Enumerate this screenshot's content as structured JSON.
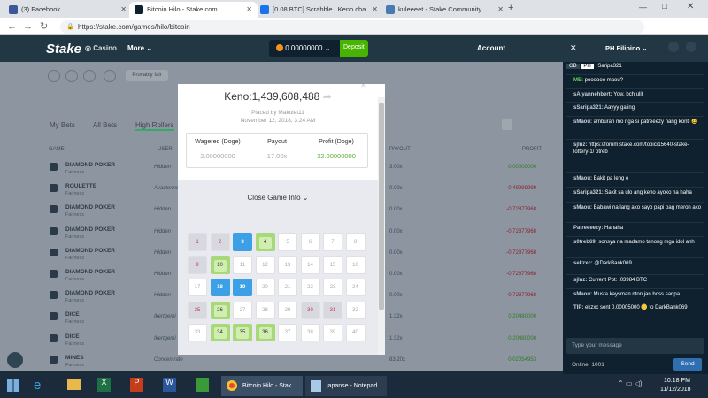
{
  "browser": {
    "tabs": [
      {
        "label": "(3) Facebook",
        "color": "#3b5998"
      },
      {
        "label": "Bitcoin Hilo - Stake.com",
        "color": "#0f212e"
      },
      {
        "label": "[0.08 BTC] Scrabble | Keno cha...",
        "color": "#1a73e8"
      },
      {
        "label": "kuleeeet - Stake Community",
        "color": "#4a7bb0"
      }
    ],
    "url": "https://stake.com/games/hilo/bitcoin"
  },
  "site": {
    "logo": "Stake",
    "casino": "Casino",
    "more": "More",
    "balance": "0.00000000",
    "deposit": "Deposit",
    "account": "Account",
    "favorite_btn": "Provably fair"
  },
  "bets": {
    "tabs": [
      "My Bets",
      "All Bets",
      "High Rollers"
    ],
    "headers": [
      "GAME",
      "USER",
      "PAYOUT",
      "PROFIT"
    ],
    "rows": [
      {
        "game": "DIAMOND POKER",
        "sub": "Fairness",
        "user": "Hidden",
        "mult": "3.00x",
        "profit": "0.00000000",
        "pos": true
      },
      {
        "game": "ROULETTE",
        "sub": "Fairness",
        "user": "Avasterine",
        "mult": "0.00x",
        "profit": "-0.49999999",
        "pos": false
      },
      {
        "game": "DIAMOND POKER",
        "sub": "Fairness",
        "user": "Hidden",
        "mult": "0.00x",
        "profit": "-0.72877968",
        "pos": false
      },
      {
        "game": "DIAMOND POKER",
        "sub": "Fairness",
        "user": "Hidden",
        "mult": "0.00x",
        "profit": "-0.72877968",
        "pos": false
      },
      {
        "game": "DIAMOND POKER",
        "sub": "Fairness",
        "user": "Hidden",
        "mult": "0.00x",
        "profit": "-0.72877968",
        "pos": false
      },
      {
        "game": "DIAMOND POKER",
        "sub": "Fairness",
        "user": "Hidden",
        "mult": "0.00x",
        "profit": "-0.72877968",
        "pos": false
      },
      {
        "game": "DIAMOND POKER",
        "sub": "Fairness",
        "user": "Hidden",
        "mult": "0.00x",
        "profit": "-0.72877968",
        "pos": false
      },
      {
        "game": "DICE",
        "sub": "Fairness",
        "user": "Ikertgemi",
        "mult": "1.32x",
        "profit": "0.20480000",
        "pos": true
      },
      {
        "game": "DICE",
        "sub": "Fairness",
        "user": "Ikertgemi",
        "mult": "1.32x",
        "profit": "0.20480000",
        "pos": true
      },
      {
        "game": "MINES",
        "sub": "Fairness",
        "user": "Concentrate",
        "mult": "83.20x",
        "profit": "0.02054953",
        "pos": true
      }
    ]
  },
  "modal": {
    "title": "Keno:1,439,608,488",
    "placed_by": "Placed by Makulet11",
    "date": "November 12, 2018, 3:24 AM",
    "wagered_label": "Wagered (Doge)",
    "wagered": "2.00000000",
    "payout_label": "Payout",
    "payout": "17.00x",
    "profit_label": "Profit (Doge)",
    "profit": "32.00000000",
    "close_info": "Close Game Info",
    "cells": [
      {
        "n": "1",
        "s": "gray"
      },
      {
        "n": "2",
        "s": "gray"
      },
      {
        "n": "3",
        "s": "blue"
      },
      {
        "n": "4",
        "s": "green"
      },
      {
        "n": "5",
        "s": ""
      },
      {
        "n": "6",
        "s": ""
      },
      {
        "n": "7",
        "s": ""
      },
      {
        "n": "8",
        "s": ""
      },
      {
        "n": "9",
        "s": "gray"
      },
      {
        "n": "10",
        "s": "green"
      },
      {
        "n": "11",
        "s": ""
      },
      {
        "n": "12",
        "s": ""
      },
      {
        "n": "13",
        "s": ""
      },
      {
        "n": "14",
        "s": ""
      },
      {
        "n": "15",
        "s": ""
      },
      {
        "n": "16",
        "s": ""
      },
      {
        "n": "17",
        "s": ""
      },
      {
        "n": "18",
        "s": "blue"
      },
      {
        "n": "19",
        "s": "blue"
      },
      {
        "n": "20",
        "s": ""
      },
      {
        "n": "21",
        "s": ""
      },
      {
        "n": "22",
        "s": ""
      },
      {
        "n": "23",
        "s": ""
      },
      {
        "n": "24",
        "s": ""
      },
      {
        "n": "25",
        "s": "gray"
      },
      {
        "n": "26",
        "s": "green"
      },
      {
        "n": "27",
        "s": ""
      },
      {
        "n": "28",
        "s": ""
      },
      {
        "n": "29",
        "s": ""
      },
      {
        "n": "30",
        "s": "grayred"
      },
      {
        "n": "31",
        "s": "grayred"
      },
      {
        "n": "32",
        "s": ""
      },
      {
        "n": "33",
        "s": ""
      },
      {
        "n": "34",
        "s": "green"
      },
      {
        "n": "35",
        "s": "green"
      },
      {
        "n": "36",
        "s": "green"
      },
      {
        "n": "37",
        "s": ""
      },
      {
        "n": "38",
        "s": ""
      },
      {
        "n": "39",
        "s": ""
      },
      {
        "n": "40",
        "s": ""
      }
    ]
  },
  "chat": {
    "language": "Filipino",
    "room_tabs": [
      "GB",
      "PH",
      "Saripa321"
    ],
    "messages": [
      {
        "user": "ME:",
        "text": "poooooo maou?"
      },
      {
        "user": "sAlyannehbert:",
        "text": "Yow, bch ulit"
      },
      {
        "user": "sSaripa321:",
        "text": "Aayyy galing"
      },
      {
        "user": "sMaou:",
        "text": "amburan mo nga si patreeezy nang konti 😀"
      },
      {
        "user": "sjlnz:",
        "text": "https://forum.stake.com/topic/15640-stake-lottery-1/ otreb"
      },
      {
        "user": "sMaou:",
        "text": "Bakit pa leng e"
      },
      {
        "user": "sSaripa321:",
        "text": "Sakit sa ulo ang keno ayoko na haha"
      },
      {
        "user": "sMaou:",
        "text": "Babawi na lang ako sayo papi pag meron ako"
      },
      {
        "user": "Patreeeezy:",
        "text": "Hahaha"
      },
      {
        "user": "s0treb69:",
        "text": "sonsya na madamo tanong mga idol ahh"
      },
      {
        "user": "sekzxc:",
        "text": "@DarkBank069"
      },
      {
        "user": "sjlnz:",
        "text": "Current Pot: .03984 BTC"
      },
      {
        "user": "sMaou:",
        "text": "Musta kaysman nton jan boss saripa"
      },
      {
        "user": "TIP: ",
        "text": "ekzxc sent 0.00005000 🪙 to DarkBank069"
      }
    ],
    "input_placeholder": "Type your message",
    "online": "Online: 1001",
    "send": "Send"
  },
  "taskbar": {
    "chrome_label": "Bitcoin Hilo - Stak...",
    "notepad_label": "japanse - Notepad",
    "time": "10:18 PM",
    "date": "11/12/2018"
  }
}
